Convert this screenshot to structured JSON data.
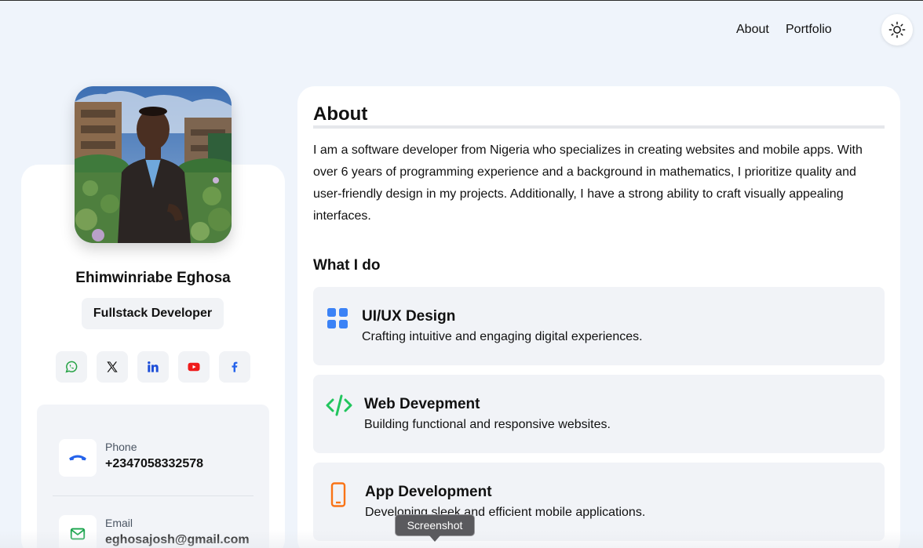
{
  "nav": {
    "about": "About",
    "portfolio": "Portfolio",
    "theme_icon": "sun-icon"
  },
  "profile": {
    "name": "Ehimwinriabe Eghosa",
    "role": "Fullstack Developer",
    "socials": [
      {
        "name": "whatsapp-icon",
        "color": "#25a244"
      },
      {
        "name": "x-icon",
        "color": "#111111"
      },
      {
        "name": "linkedin-icon",
        "color": "#1d4ed8"
      },
      {
        "name": "youtube-icon",
        "color": "#ef1b1b"
      },
      {
        "name": "facebook-icon",
        "color": "#2563eb"
      }
    ]
  },
  "contact": {
    "phone": {
      "label": "Phone",
      "value": "+2347058332578",
      "icon": "phone-icon",
      "color": "#2563eb"
    },
    "email": {
      "label": "Email",
      "value": "eghosajosh@gmail.com",
      "icon": "mail-icon",
      "color": "#16a34a"
    }
  },
  "about": {
    "title": "About",
    "text": "I am a software developer from Nigeria who specializes in creating websites and mobile apps. With over 6 years of programming experience and a background in mathematics, I prioritize quality and user-friendly design in my projects. Additionally, I have a strong ability to craft visually appealing interfaces.",
    "whatido": "What I do",
    "services": [
      {
        "title": "UI/UX Design",
        "desc": "Crafting intuitive and engaging digital experiences.",
        "icon": "grid-icon",
        "color": "#3b82f6"
      },
      {
        "title": "Web Devepment",
        "desc": "Building functional and responsive websites.",
        "icon": "code-icon",
        "color": "#22c55e"
      },
      {
        "title": "App Development",
        "desc": "Developing sleek and efficient mobile applications.",
        "icon": "mobile-icon",
        "color": "#f97316"
      }
    ]
  },
  "tooltip": {
    "label": "Screenshot"
  }
}
